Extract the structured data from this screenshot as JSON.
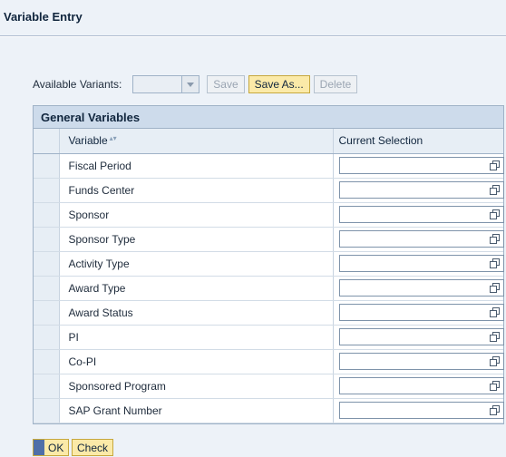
{
  "window": {
    "title": "Variable Entry"
  },
  "variants": {
    "label": "Available Variants:",
    "selected": "",
    "save_label": "Save",
    "save_as_label": "Save As...",
    "delete_label": "Delete"
  },
  "table": {
    "title": "General Variables",
    "columns": {
      "variable": "Variable",
      "current_selection": "Current Selection"
    },
    "sort_icon": "sort-icon",
    "rows": [
      {
        "variable": "Fiscal Period",
        "value": ""
      },
      {
        "variable": "Funds Center",
        "value": ""
      },
      {
        "variable": "Sponsor",
        "value": ""
      },
      {
        "variable": "Sponsor Type",
        "value": ""
      },
      {
        "variable": "Activity Type",
        "value": ""
      },
      {
        "variable": "Award Type",
        "value": ""
      },
      {
        "variable": "Award Status",
        "value": ""
      },
      {
        "variable": "PI",
        "value": ""
      },
      {
        "variable": "Co-PI",
        "value": ""
      },
      {
        "variable": "Sponsored Program",
        "value": ""
      },
      {
        "variable": "SAP Grant Number",
        "value": ""
      }
    ]
  },
  "footer": {
    "ok_label": "OK",
    "check_label": "Check"
  },
  "colors": {
    "accent_button": "#fbeaa8",
    "panel_bg": "#edf2f8",
    "header_bg": "#cddbeb"
  },
  "icons": {
    "value_help": "copy-icon",
    "dropdown": "chevron-down-icon"
  }
}
